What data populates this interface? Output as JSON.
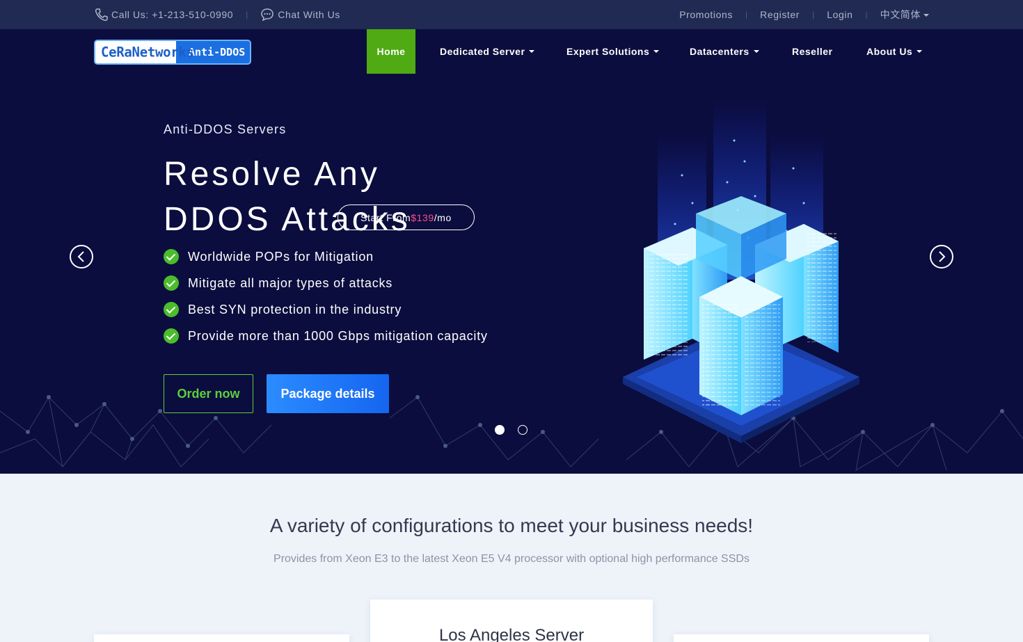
{
  "topbar": {
    "phone_label": "Call Us: +1-213-510-0990",
    "chat_label": "Chat With Us",
    "promotions": "Promotions",
    "register": "Register",
    "login": "Login",
    "language": "中文简体"
  },
  "brand": {
    "logo_part1": "CeRaNetworks",
    "logo_part2": "Anti-DDOS"
  },
  "nav": {
    "items": [
      {
        "label": "Home",
        "dropdown": false,
        "active": true
      },
      {
        "label": "Dedicated Server",
        "dropdown": true
      },
      {
        "label": "Expert Solutions",
        "dropdown": true
      },
      {
        "label": "Datacenters",
        "dropdown": true
      },
      {
        "label": "Reseller",
        "dropdown": false
      },
      {
        "label": "About Us",
        "dropdown": true
      }
    ]
  },
  "hero": {
    "eyebrow": "Anti-DDOS Servers",
    "headline": "Resolve Any DDOS Attacks",
    "price_prefix": "Start From ",
    "price_amount": "$139",
    "price_suffix": "/mo",
    "features": [
      "Worldwide POPs for Mitigation",
      "Mitigate all major types of attacks",
      "Best SYN protection in the industry",
      "Provide more than 1000 Gbps mitigation capacity"
    ],
    "order_button": "Order now",
    "package_button": "Package details",
    "slides_total": 2,
    "slide_active": 1
  },
  "section": {
    "title": "A variety of configurations to meet your business needs!",
    "subtitle": "Provides from Xeon E3 to the latest Xeon E5 V4 processor with optional high performance SSDs",
    "featured_card_title": "Los Angeles Server"
  },
  "colors": {
    "topbar_bg": "#202a52",
    "hero_bg": "#0b0d3e",
    "active_nav": "#4faa13",
    "accent_blue": "#1f7af7",
    "accent_green": "#5ccf3a",
    "price_pink": "#ff4d8d"
  },
  "icons": {
    "phone": "phone-icon",
    "chat": "chat-bubble-icon",
    "prev": "chevron-left-icon",
    "next": "chevron-right-icon",
    "check": "check-circle-icon"
  }
}
